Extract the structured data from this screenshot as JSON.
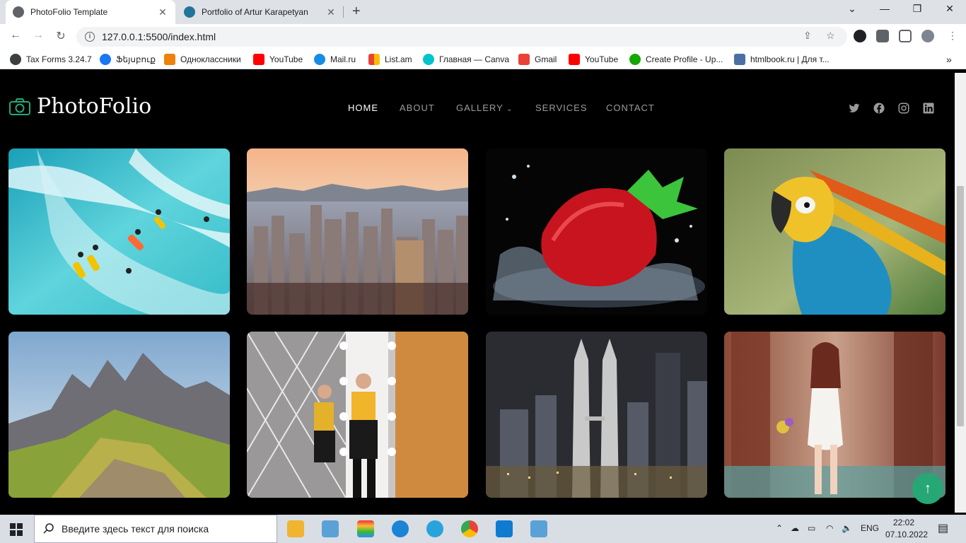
{
  "browser": {
    "tabs": [
      {
        "title": "PhotoFolio Template",
        "active": true
      },
      {
        "title": "Portfolio of Artur Karapetyan",
        "active": false
      }
    ],
    "url": "127.0.0.1:5500/index.html",
    "bookmarks": [
      "Tax Forms 3.24.7",
      "Ֆեյսբուք",
      "Одноклассники",
      "YouTube",
      "Mail.ru",
      "List.am",
      "Главная — Canva",
      "Gmail",
      "YouTube",
      "Create Profile - Up...",
      "htmlbook.ru | Для т..."
    ]
  },
  "site": {
    "brand": "PhotoFolio",
    "nav": [
      "HOME",
      "ABOUT",
      "GALLERY",
      "SERVICES",
      "CONTACT"
    ],
    "active_nav": "HOME",
    "social": [
      "twitter-icon",
      "facebook-icon",
      "instagram-icon",
      "linkedin-icon"
    ],
    "accent": "#27a776",
    "gallery": [
      {
        "subject": "surfers on turquoise wave"
      },
      {
        "subject": "city skyline at sunset"
      },
      {
        "subject": "strawberry splash"
      },
      {
        "subject": "macaw parrot"
      },
      {
        "subject": "mountain ridge"
      },
      {
        "subject": "women in mirror room"
      },
      {
        "subject": "night city towers"
      },
      {
        "subject": "woman with flowers in forest"
      }
    ]
  },
  "taskbar": {
    "search_placeholder": "Введите здесь текст для поиска",
    "language": "ENG",
    "time": "22:02",
    "date": "07.10.2022"
  }
}
